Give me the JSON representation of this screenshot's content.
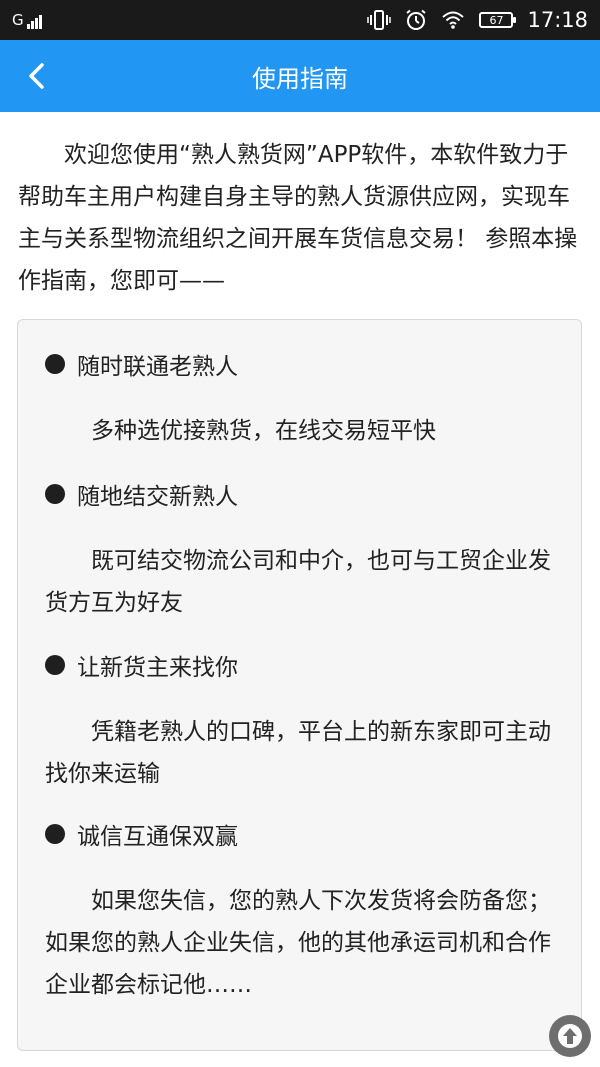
{
  "status_bar": {
    "carrier": "G",
    "battery": "67",
    "time": "17:18"
  },
  "header": {
    "title": "使用指南"
  },
  "intro": "欢迎您使用“熟人熟货网”APP软件，本软件致力于帮助车主用户构建自身主导的熟人货源供应网，实现车主与关系型物流组织之间开展车货信息交易！ 参照本操作指南，您即可——",
  "features": [
    {
      "title": "随时联通老熟人",
      "desc": "多种选优接熟货，在线交易短平快"
    },
    {
      "title": "随地结交新熟人",
      "desc": "既可结交物流公司和中介，也可与工贸企业发货方互为好友"
    },
    {
      "title": "让新货主来找你",
      "desc": "凭籍老熟人的口碑，平台上的新东家即可主动找你来运输"
    },
    {
      "title": "诚信互通保双赢",
      "desc": "如果您失信，您的熟人下次发货将会防备您；如果您的熟人企业失信，他的其他承运司机和合作企业都会标记他……"
    }
  ],
  "colors": {
    "header_bg": "#2196f3",
    "status_bg": "#1a1a1a",
    "card_bg": "#f6f6f6"
  }
}
